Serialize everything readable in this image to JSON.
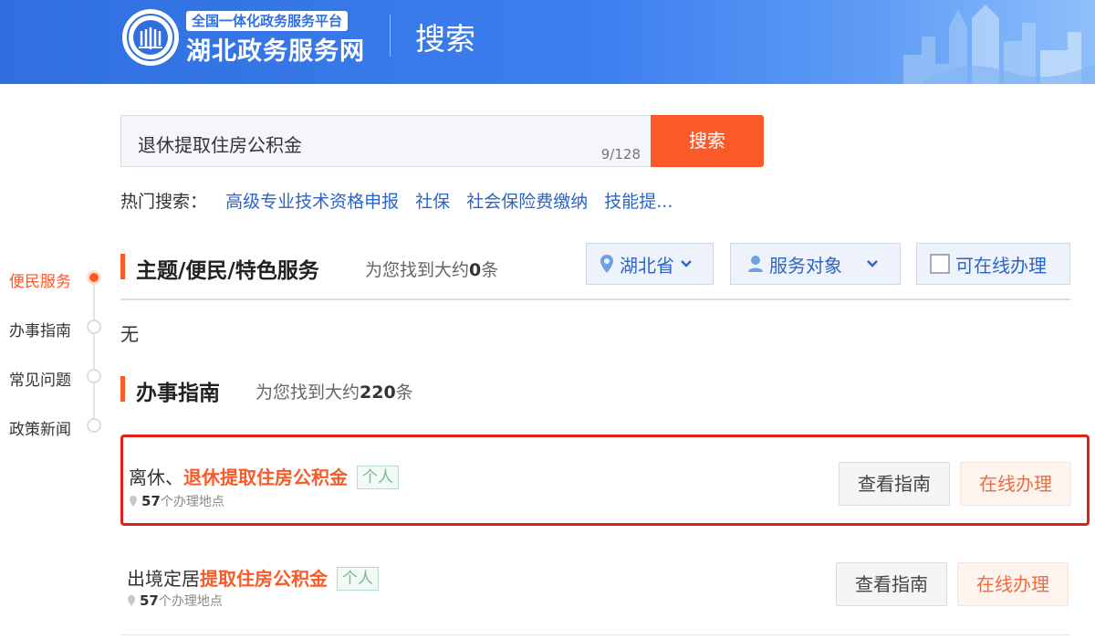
{
  "header": {
    "platform_tag": "全国一体化政务服务平台",
    "site_name": "湖北政务服务网",
    "page_title": "搜索"
  },
  "search": {
    "query": "退休提取住房公积金",
    "char_count": "9/128",
    "button_label": "搜索"
  },
  "hot_search": {
    "label": "热门搜索：",
    "items": [
      "高级专业技术资格申报",
      "社保",
      "社会保险费缴纳",
      "技能提..."
    ]
  },
  "side_nav": {
    "items": [
      {
        "label": "便民服务",
        "active": true
      },
      {
        "label": "办事指南",
        "active": false
      },
      {
        "label": "常见问题",
        "active": false
      },
      {
        "label": "政策新闻",
        "active": false
      }
    ]
  },
  "section_theme": {
    "title": "主题/便民/特色服务",
    "found_prefix": "为您找到大约",
    "found_count": "0",
    "found_suffix": "条",
    "empty_text": "无"
  },
  "filters": {
    "region": "湖北省",
    "audience": "服务对象",
    "online_only": "可在线办理"
  },
  "section_guide": {
    "title": "办事指南",
    "found_prefix": "为您找到大约",
    "found_count": "220",
    "found_suffix": "条"
  },
  "results": [
    {
      "title_prefix": "离休、",
      "title_keyword": "退休提取住房公积金",
      "tag": "个人",
      "location_count": "57",
      "location_suffix": "个办理地点",
      "guide_button": "查看指南",
      "online_button": "在线办理"
    },
    {
      "title_prefix": "出境定居",
      "title_keyword": "提取住房公积金",
      "tag": "个人",
      "location_count": "57",
      "location_suffix": "个办理地点",
      "guide_button": "查看指南",
      "online_button": "在线办理"
    }
  ],
  "colors": {
    "header_blue": "#2f6fe0",
    "accent_orange": "#fa5a28",
    "link_blue": "#2d64c8",
    "highlight_red": "#e22218"
  }
}
